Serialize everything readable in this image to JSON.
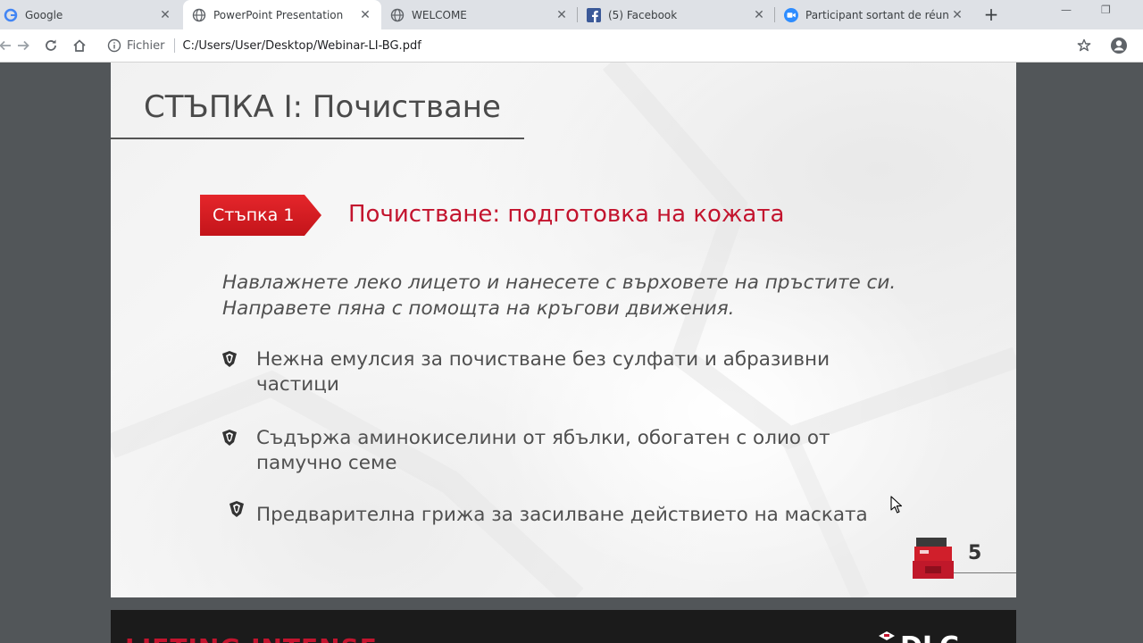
{
  "tabs": [
    {
      "title": "Google",
      "icon": "google-icon",
      "active": false
    },
    {
      "title": "PowerPoint Presentation",
      "icon": "globe-icon",
      "active": true
    },
    {
      "title": "WELCOME",
      "icon": "globe-icon",
      "active": false
    },
    {
      "title": "(5) Facebook",
      "icon": "facebook-icon",
      "active": false
    },
    {
      "title": "Participant sortant de réunion",
      "icon": "zoom-icon",
      "active": false
    }
  ],
  "window_controls": {
    "minimize": "—",
    "restore": "❐"
  },
  "toolbar": {
    "scheme": "Fichier",
    "url": "C:/Users/User/Desktop/Webinar-LI-BG.pdf"
  },
  "slide": {
    "title": "СТЪПКА I: Почистване",
    "step_badge": "Стъпка 1",
    "step_heading": "Почистване: подготовка на кожата",
    "intro_lines": [
      "Навлажнете леко лицето и нанесете с върховете на пръстите си.",
      "Направете пяна с помощта на кръгови движения."
    ],
    "bullets": [
      {
        "lines": [
          "Нежна емулсия за почистване без сулфати и абразивни",
          "частици"
        ]
      },
      {
        "lines": [
          "Съдържа аминокиселини от ябълки, обогатен с олио от",
          "памучно семе"
        ]
      },
      {
        "lines": [
          "Предварителна грижа за засилване действието на маската"
        ]
      }
    ],
    "page_number": "5"
  },
  "next_page": {
    "heading": "LIFTING INTENSE",
    "logo": "DLC"
  },
  "colors": {
    "accent_red": "#c3142e",
    "badge_red": "#d81e25",
    "viewer_bg": "#525659"
  }
}
